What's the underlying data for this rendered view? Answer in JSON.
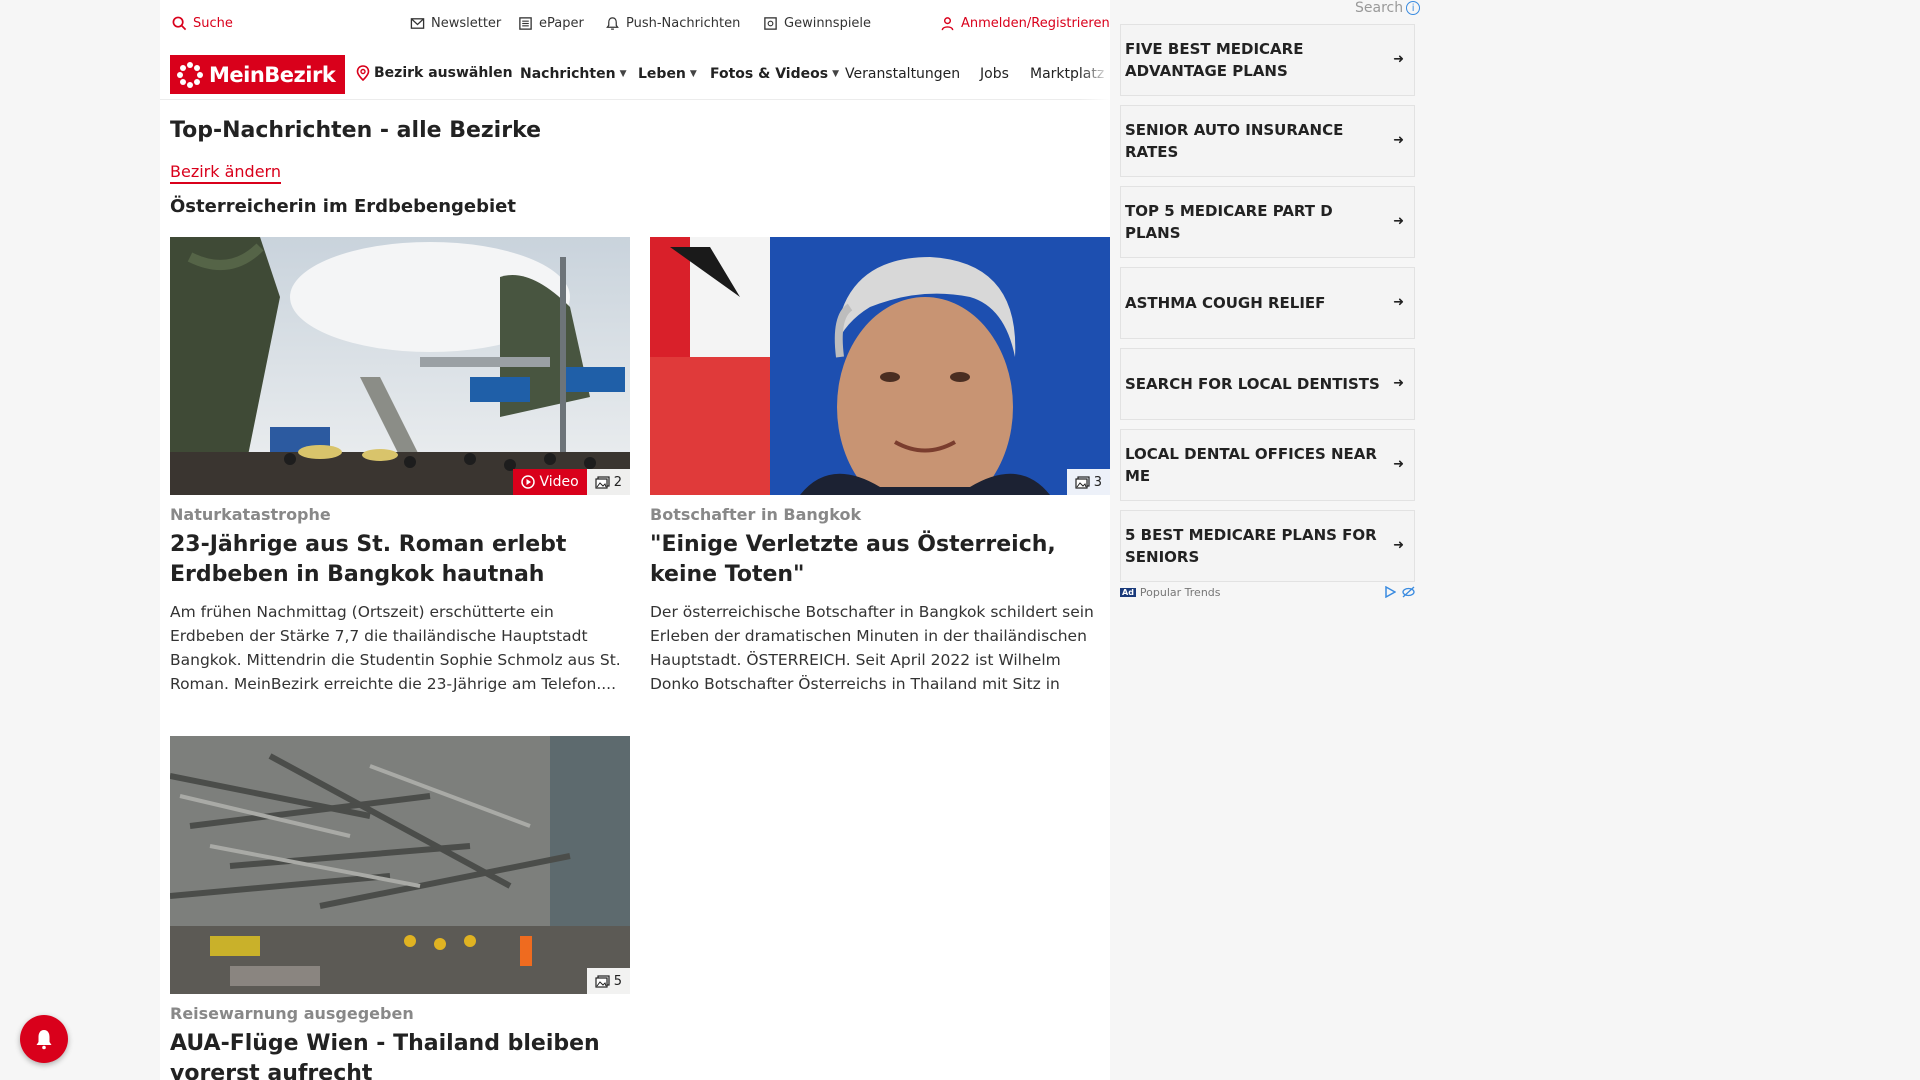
{
  "util_bar": {
    "search": "Suche",
    "newsletter": "Newsletter",
    "epaper": "ePaper",
    "push": "Push-Nachrichten",
    "gewinnspiele": "Gewinnspiele",
    "login": "Anmelden/Registrieren"
  },
  "nav": {
    "logo": "MeinBezirk",
    "bezirk": "Bezirk auswählen",
    "items": [
      "Nachrichten",
      "Leben",
      "Fotos & Videos",
      "Veranstaltungen",
      "Jobs",
      "Marktplatz"
    ]
  },
  "main": {
    "title": "Top-Nachrichten - alle Bezirke",
    "bezirk_link": "Bezirk ändern",
    "subtitle": "Österreicherin im Erdbebengebiet"
  },
  "articles": [
    {
      "kicker": "Naturkatastrophe",
      "headline": "23-Jährige aus St. Roman erlebt Erdbeben in Bangkok hautnah",
      "teaser": "Am frühen Nachmittag (Ortszeit) erschütterte ein Erdbeben der Stärke 7,7 die thailändische Hauptstadt Bangkok. Mittendrin die Studentin Sophie Schmolz aus St. Roman. MeinBezirk erreichte die 23-Jährige am Telefon....",
      "video_label": "Video",
      "gallery_count": "2"
    },
    {
      "kicker": "Botschafter in Bangkok",
      "headline": "\"Einige Verletzte aus Österreich, keine Toten\"",
      "teaser": "Der österreichische Botschafter in Bangkok schildert sein Erleben der dramatischen Minuten in der thailändischen Hauptstadt. ÖSTERREICH. Seit April 2022 ist Wilhelm Donko Botschafter Österreichs in Thailand mit Sitz in Bangkok. I...",
      "gallery_count": "3"
    },
    {
      "kicker": "Reisewarnung ausgegeben",
      "headline": "AUA-Flüge Wien - Thailand bleiben vorerst aufrecht",
      "gallery_count": "5"
    }
  ],
  "ad": {
    "search_label": "Search",
    "items": [
      "FIVE BEST MEDICARE ADVANTAGE PLANS",
      "SENIOR AUTO INSURANCE RATES",
      "TOP 5 MEDICARE PART D PLANS",
      "ASTHMA COUGH RELIEF",
      "SEARCH FOR LOCAL DENTISTS",
      "LOCAL DENTAL OFFICES NEAR ME",
      "5 BEST MEDICARE PLANS FOR SENIORS"
    ],
    "ad_tag": "Ad",
    "footer_label": "Popular Trends"
  },
  "colors": {
    "brand": "#d9001b"
  }
}
